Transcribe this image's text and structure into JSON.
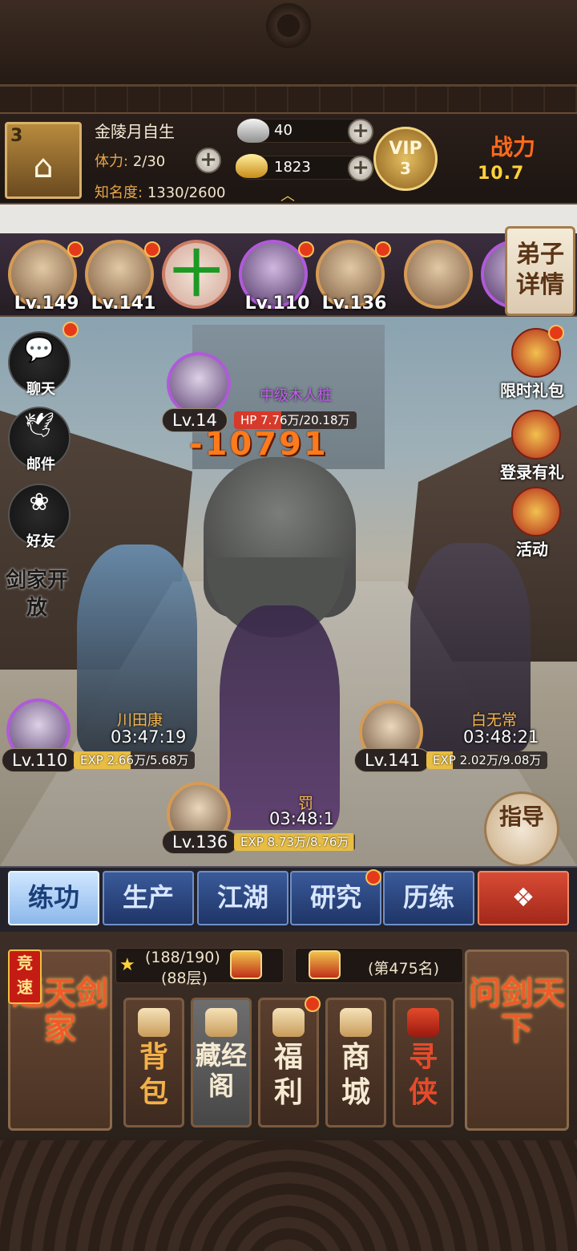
{
  "header": {
    "player_level": "3",
    "player_name": "金陵月自生",
    "stamina_label": "体力:",
    "stamina_value": "2/30",
    "fame_label": "知名度:",
    "fame_value": "1330/2600",
    "silver": "40",
    "gold": "1823",
    "vip_label": "VIP",
    "vip_level": "3",
    "power_label": "战力",
    "power_value": "10.7"
  },
  "heroes": [
    {
      "level": "Lv.149"
    },
    {
      "level": "Lv.141"
    },
    {
      "add": "十"
    },
    {
      "level": "Lv.110"
    },
    {
      "level": "Lv.136"
    }
  ],
  "disciple_details": "弟子详情",
  "side_buttons": {
    "chat": "聊天",
    "mail": "邮件",
    "friends": "好友",
    "sword_open": "剑家开放"
  },
  "event_buttons": {
    "limited_gift": "限时礼包",
    "login_gift": "登录有礼",
    "activity": "活动"
  },
  "enemy": {
    "name": "中级木人桩",
    "level": "Lv.14",
    "hp": "HP 7.76万/20.18万",
    "hp_fraction": 0.385,
    "damage": "-10791"
  },
  "units": [
    {
      "name": "川田康",
      "timer": "03:47:19",
      "level": "Lv.110",
      "exp": "EXP 2.66万/5.68万",
      "exp_fraction": 0.47
    },
    {
      "name": "白无常",
      "timer": "03:48:21",
      "level": "Lv.141",
      "exp": "EXP 2.02万/9.08万",
      "exp_fraction": 0.22
    },
    {
      "name": "罚",
      "timer": "03:48:1",
      "level": "Lv.136",
      "exp": "EXP 8.73万/8.76万",
      "exp_fraction": 0.99
    }
  ],
  "guide": "指导",
  "tabs": [
    "练功",
    "生产",
    "江湖",
    "研究",
    "历练"
  ],
  "bottom": {
    "speed_badge": "竞速",
    "left_card": "通天剑家",
    "right_card": "问剑天下",
    "stars": "(188/190)",
    "floor": "(88层)",
    "rank": "(第475名)",
    "cards": [
      "背包",
      "藏经阁",
      "福利",
      "商城",
      "寻侠"
    ]
  },
  "colors": {
    "accent_gold": "#e7a64a",
    "tab_blue": "#1f3566",
    "enemy_purple": "#c45cf0",
    "damage_orange": "#ff7a1a"
  }
}
